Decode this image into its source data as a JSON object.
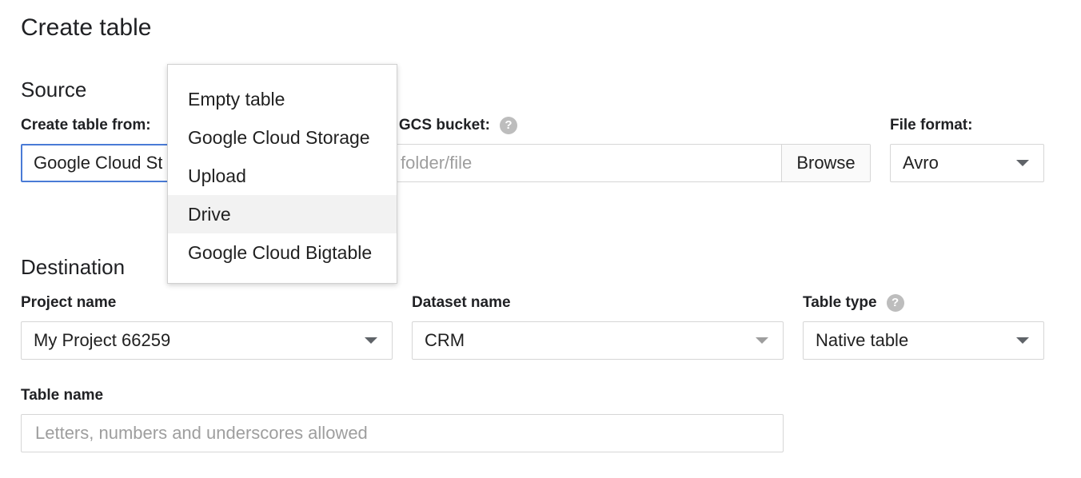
{
  "page": {
    "title": "Create table"
  },
  "source": {
    "section_title": "Source",
    "create_from_label": "Create table from:",
    "create_from_value": "Google Cloud St",
    "gcs_label_visible": "n GCS bucket:",
    "gcs_input_placeholder_visible": "folder/file",
    "browse_label": "Browse",
    "file_format_label": "File format:",
    "file_format_value": "Avro"
  },
  "dropdown_menu": {
    "items": [
      {
        "label": "Empty table"
      },
      {
        "label": "Google Cloud Storage"
      },
      {
        "label": "Upload"
      },
      {
        "label": "Drive",
        "highlighted": true
      },
      {
        "label": "Google Cloud Bigtable"
      }
    ]
  },
  "destination": {
    "section_title": "Destination",
    "project_label": "Project name",
    "project_value": "My Project 66259",
    "dataset_label": "Dataset name",
    "dataset_value": "CRM",
    "table_type_label": "Table type",
    "table_type_value": "Native table",
    "table_name_label": "Table name",
    "table_name_placeholder": "Letters, numbers and underscores allowed"
  },
  "icons": {
    "help": "?"
  },
  "colors": {
    "focus_border": "#4a7bd6",
    "hover_bg": "#f2f2f2"
  }
}
